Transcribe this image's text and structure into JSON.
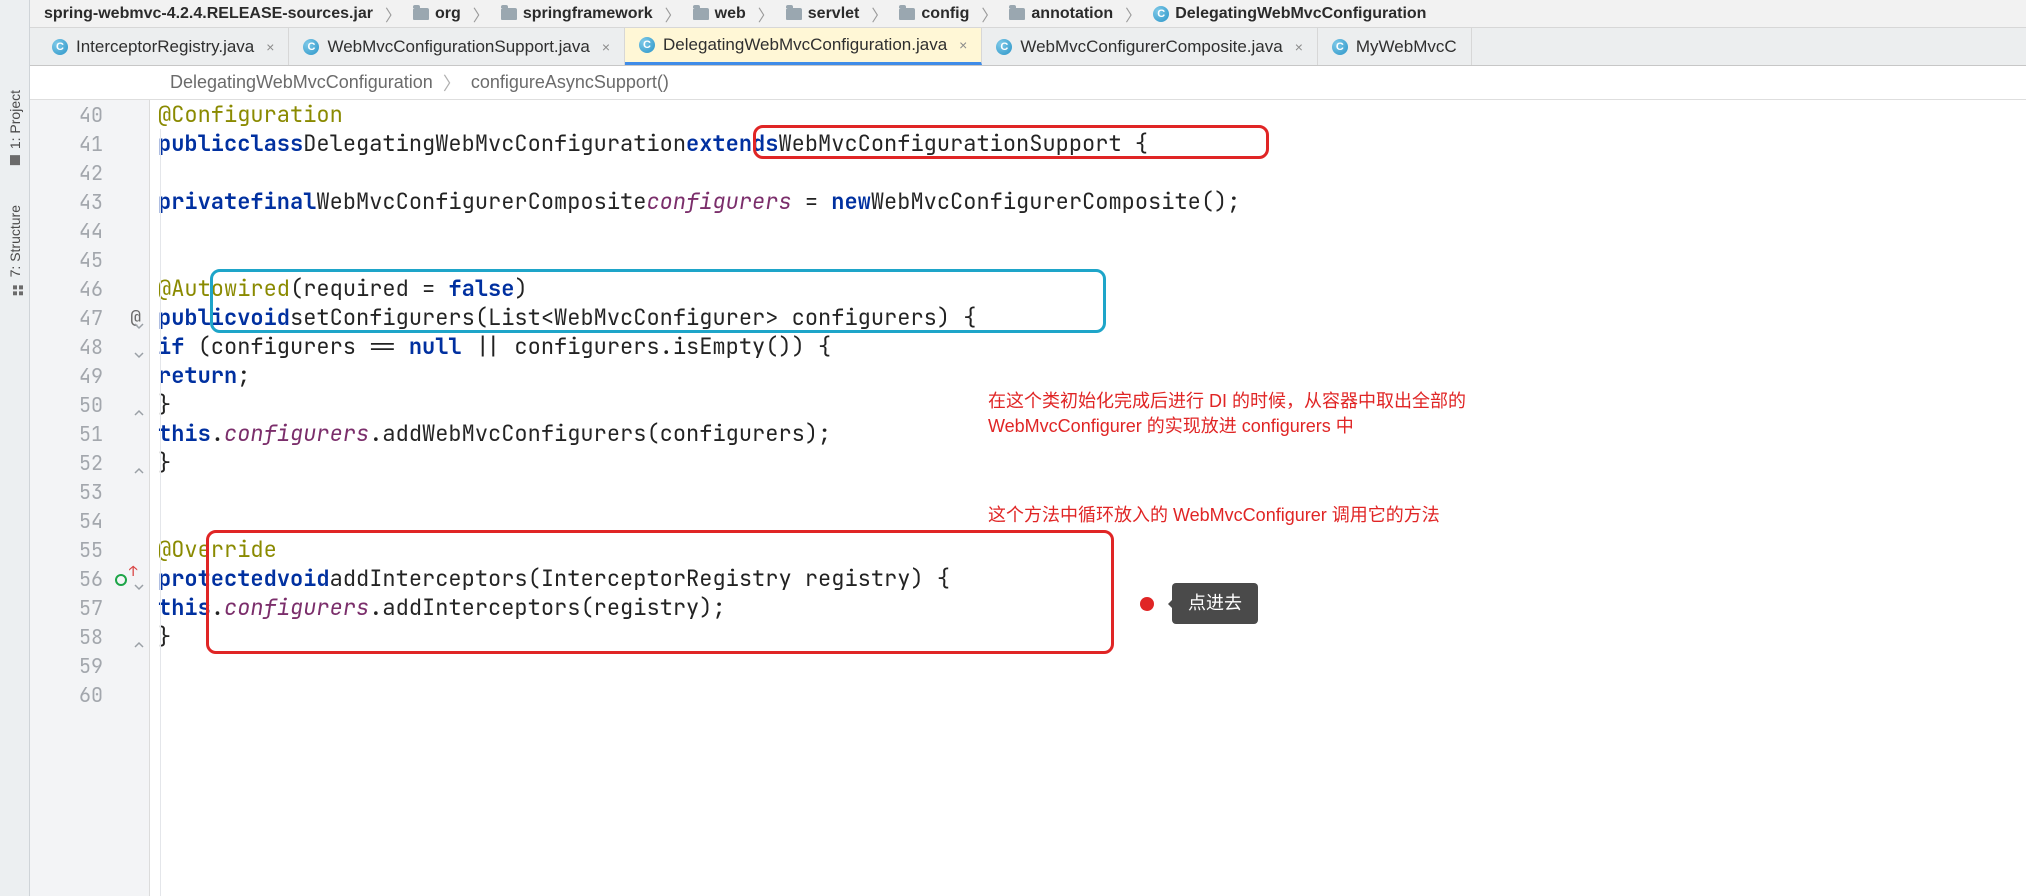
{
  "sidetools": {
    "project": "1: Project",
    "structure": "7: Structure"
  },
  "breadcrumb": {
    "jar": "spring-webmvc-4.2.4.RELEASE-sources.jar",
    "p1": "org",
    "p2": "springframework",
    "p3": "web",
    "p4": "servlet",
    "p5": "config",
    "p6": "annotation",
    "cls": "DelegatingWebMvcConfiguration"
  },
  "tabs": {
    "t1": "InterceptorRegistry.java",
    "t2": "WebMvcConfigurationSupport.java",
    "t3": "DelegatingWebMvcConfiguration.java",
    "t4": "WebMvcConfigurerComposite.java",
    "t5": "MyWebMvcC"
  },
  "subcrumb": {
    "c1": "DelegatingWebMvcConfiguration",
    "c2": "configureAsyncSupport()"
  },
  "lines": {
    "l40": "40",
    "l41": "41",
    "l42": "42",
    "l43": "43",
    "l44": "44",
    "l45": "45",
    "l46": "46",
    "l47": "47",
    "l48": "48",
    "l49": "49",
    "l50": "50",
    "l51": "51",
    "l52": "52",
    "l53": "53",
    "l54": "54",
    "l55": "55",
    "l56": "56",
    "l57": "57",
    "l58": "58",
    "l59": "59",
    "l60": "60"
  },
  "code": {
    "ann_conf": "@Configuration",
    "kw_public": "public",
    "kw_class": "class",
    "cls_name": "DelegatingWebMvcConfiguration",
    "kw_extends": "extends",
    "super_name": "WebMvcConfigurationSupport",
    "brace_open": " {",
    "kw_private": "private",
    "kw_final": "final",
    "type_comp": "WebMvcConfigurerComposite",
    "field_conf": "configurers",
    "eq": " = ",
    "kw_new": "new",
    "ctor": "WebMvcConfigurerComposite()",
    "semi": ";",
    "ann_auto": "@Autowired",
    "auto_args_open": "(",
    "auto_arg_name": "required",
    "auto_eq": " = ",
    "kw_false": "false",
    "auto_args_close": ")",
    "kw_void": "void",
    "m_set": "setConfigurers",
    "param_open": "(",
    "type_list": "List",
    "lt": "<",
    "type_wmc": "WebMvcConfigurer",
    "gt": ">",
    "param_name": " configurers",
    "param_close": ") {",
    "kw_if": "if",
    "if_open": " (configurers == ",
    "kw_null": "null",
    "if_or": " || configurers.isEmpty()) {",
    "kw_return": "return",
    "close_brace": "}",
    "kw_this": "this",
    "dot": ".",
    "m_add": "addWebMvcConfigurers",
    "call_args": "(configurers);",
    "ann_over": "@Override",
    "kw_protected": "protected",
    "m_addint": "addInterceptors",
    "p_reg": "(InterceptorRegistry registry) {",
    "m_addint2": "addInterceptors",
    "call_reg": "(registry);"
  },
  "notes": {
    "n1a": "在这个类初始化完成后进行 DI 的时候，从容器中取出全部的",
    "n1b": "WebMvcConfigurer 的实现放进 configurers 中",
    "n2": "这个方法中循环放入的 WebMvcConfigurer 调用它的方法",
    "callout": "点进去"
  },
  "gutter_at": "@"
}
